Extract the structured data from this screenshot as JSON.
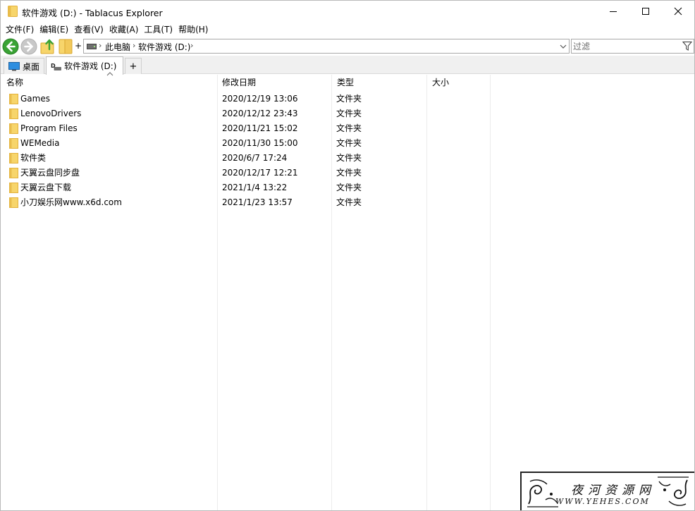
{
  "window": {
    "title": "软件游戏 (D:) - Tablacus Explorer"
  },
  "menubar": {
    "items": [
      "文件(F)",
      "编辑(E)",
      "查看(V)",
      "收藏(A)",
      "工具(T)",
      "帮助(H)"
    ]
  },
  "toolbar": {
    "plus_label": "+"
  },
  "address": {
    "crumbs": [
      "此电脑",
      "软件游戏 (D:)"
    ],
    "separator": "›"
  },
  "filter": {
    "placeholder": "过滤",
    "value": ""
  },
  "tabs": {
    "items": [
      {
        "label": "桌面",
        "icon": "desktop-icon",
        "active": false
      },
      {
        "label": "软件游戏 (D:)",
        "icon": "drive-icon",
        "active": true
      }
    ],
    "add_label": "+"
  },
  "list": {
    "columns": {
      "name": "名称",
      "date": "修改日期",
      "type": "类型",
      "size": "大小"
    },
    "rows": [
      {
        "name": "Games",
        "date": "2020/12/19 13:06",
        "type": "文件夹",
        "size": ""
      },
      {
        "name": "LenovoDrivers",
        "date": "2020/12/12 23:43",
        "type": "文件夹",
        "size": ""
      },
      {
        "name": "Program Files",
        "date": "2020/11/21 15:02",
        "type": "文件夹",
        "size": ""
      },
      {
        "name": "WEMedia",
        "date": "2020/11/30 15:00",
        "type": "文件夹",
        "size": ""
      },
      {
        "name": "软件类",
        "date": "2020/6/7 17:24",
        "type": "文件夹",
        "size": ""
      },
      {
        "name": "天翼云盘同步盘",
        "date": "2020/12/17 12:21",
        "type": "文件夹",
        "size": ""
      },
      {
        "name": "天翼云盘下载",
        "date": "2021/1/4 13:22",
        "type": "文件夹",
        "size": ""
      },
      {
        "name": "小刀娱乐网www.x6d.com",
        "date": "2021/1/23 13:57",
        "type": "文件夹",
        "size": ""
      }
    ]
  },
  "watermark": {
    "cn": "夜河资源网",
    "en": "WWW.YEHES.COM"
  },
  "colors": {
    "folder": "#f7d56b",
    "folder_dark": "#e3b13c",
    "nav_green": "#3aa335",
    "nav_disabled": "#c8c8c8",
    "tab_strip": "#f0f0f0"
  }
}
